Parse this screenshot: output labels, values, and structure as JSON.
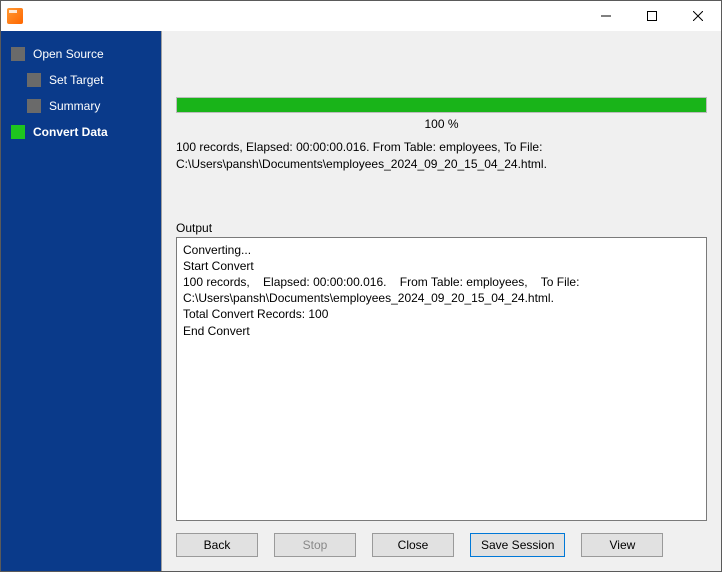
{
  "sidebar": {
    "items": [
      {
        "label": "Open Source",
        "active": false,
        "child": false
      },
      {
        "label": "Set Target",
        "active": false,
        "child": true
      },
      {
        "label": "Summary",
        "active": false,
        "child": true
      },
      {
        "label": "Convert Data",
        "active": true,
        "child": false
      }
    ]
  },
  "progress": {
    "percent_text": "100 %",
    "percent": 100
  },
  "status": {
    "line1": "100 records,    Elapsed: 00:00:00.016.    From Table: employees,    To File:",
    "line2": "C:\\Users\\pansh\\Documents\\employees_2024_09_20_15_04_24.html."
  },
  "output": {
    "label": "Output",
    "text": "Converting...\nStart Convert\n100 records,    Elapsed: 00:00:00.016.    From Table: employees,    To File: C:\\Users\\pansh\\Documents\\employees_2024_09_20_15_04_24.html.\nTotal Convert Records: 100\nEnd Convert"
  },
  "buttons": {
    "back": "Back",
    "stop": "Stop",
    "close": "Close",
    "save_session": "Save Session",
    "view": "View"
  }
}
